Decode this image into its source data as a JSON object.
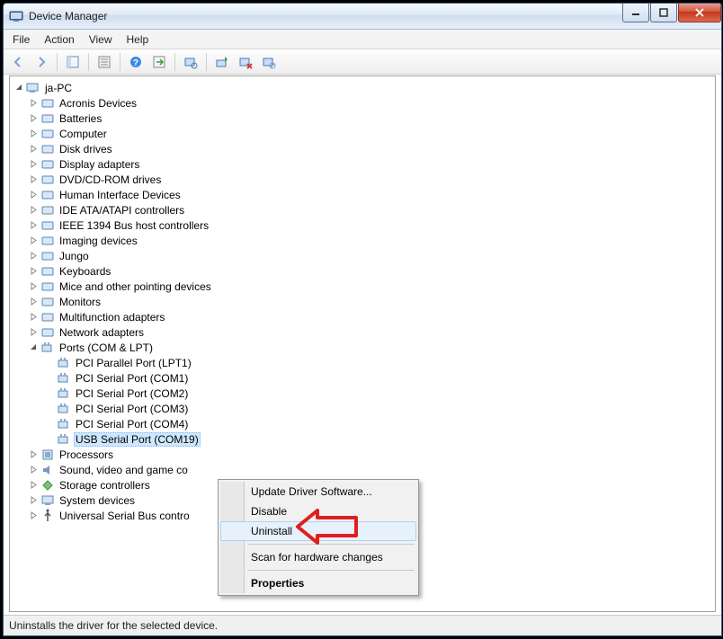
{
  "window": {
    "title": "Device Manager"
  },
  "menu": {
    "file": "File",
    "action": "Action",
    "view": "View",
    "help": "Help"
  },
  "tree": {
    "root": "ja-PC",
    "items": [
      "Acronis Devices",
      "Batteries",
      "Computer",
      "Disk drives",
      "Display adapters",
      "DVD/CD-ROM drives",
      "Human Interface Devices",
      "IDE ATA/ATAPI controllers",
      "IEEE 1394 Bus host controllers",
      "Imaging devices",
      "Jungo",
      "Keyboards",
      "Mice and other pointing devices",
      "Monitors",
      "Multifunction adapters",
      "Network adapters"
    ],
    "ports_label": "Ports (COM & LPT)",
    "ports": [
      "PCI Parallel Port (LPT1)",
      "PCI Serial Port (COM1)",
      "PCI Serial Port (COM2)",
      "PCI Serial Port (COM3)",
      "PCI Serial Port (COM4)",
      "USB Serial Port (COM19)"
    ],
    "after": [
      "Processors",
      "Sound, video and game co",
      "Storage controllers",
      "System devices",
      "Universal Serial Bus contro"
    ]
  },
  "ctx": {
    "update": "Update Driver Software...",
    "disable": "Disable",
    "uninstall": "Uninstall",
    "scan": "Scan for hardware changes",
    "properties": "Properties"
  },
  "status": "Uninstalls the driver for the selected device."
}
